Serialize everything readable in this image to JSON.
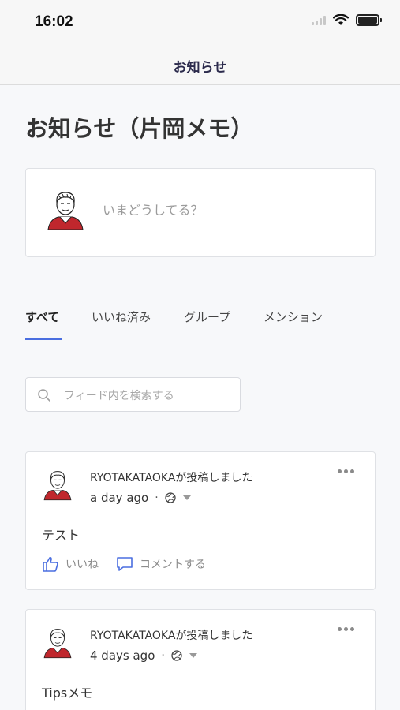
{
  "status_bar": {
    "time": "16:02"
  },
  "nav": {
    "title": "お知らせ"
  },
  "page": {
    "title": "お知らせ（片岡メモ）"
  },
  "compose": {
    "placeholder": "いまどうしてる？"
  },
  "tabs": [
    {
      "label": "すべて",
      "active": true
    },
    {
      "label": "いいね済み",
      "active": false
    },
    {
      "label": "グループ",
      "active": false
    },
    {
      "label": "メンション",
      "active": false
    }
  ],
  "search": {
    "placeholder": "フィード内を検索する"
  },
  "posts": [
    {
      "author": "RYOTAKATAOKAが投稿しました",
      "time": "a day ago",
      "dot": "·",
      "body": "テスト",
      "like_label": "いいね",
      "comment_label": "コメントする"
    },
    {
      "author": "RYOTAKATAOKAが投稿しました",
      "time": "4 days ago",
      "dot": "·",
      "body": "Tipsメモ"
    }
  ],
  "colors": {
    "accent": "#4a6ee0",
    "nav_title": "#2b2a4c",
    "avatar_shirt": "#c0272d"
  }
}
